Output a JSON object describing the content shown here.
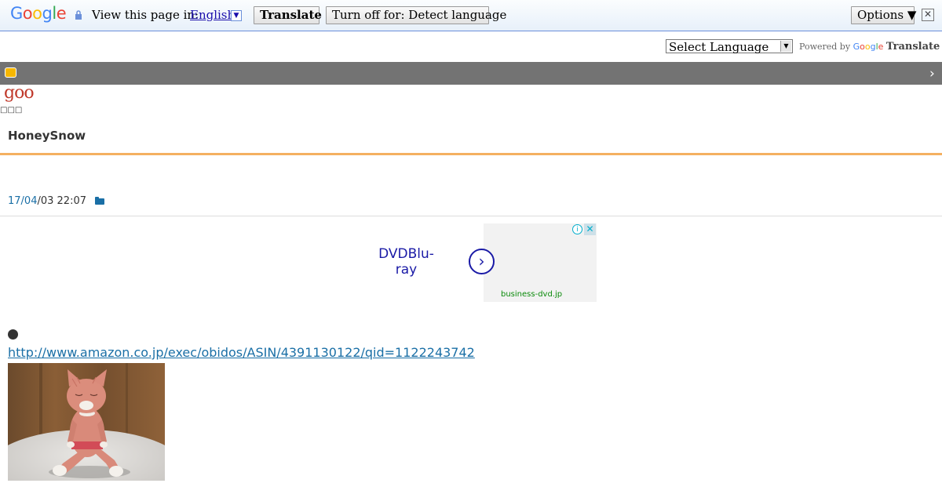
{
  "translate_bar": {
    "logo": [
      "G",
      "o",
      "o",
      "g",
      "l",
      "e"
    ],
    "view_text": "View this page in:",
    "language": "English",
    "translate_label": "Translate",
    "turn_off_label": "Turn off for: Detect language",
    "options_label": "Options ▼",
    "close_label": "✕"
  },
  "language_widget": {
    "select_value": "Select Language",
    "powered_by": "Powered by",
    "google_label": "Google",
    "translate_label": "Translate"
  },
  "site": {
    "logo": "goo",
    "boxes": "□□□",
    "blog_title": "HoneySnow"
  },
  "post": {
    "date_link": "17/04",
    "date_rest": "/03 22:07",
    "amazon_url": "http://www.amazon.co.jp/exec/obidos/ASIN/4391130122/qid=1122243742"
  },
  "ad": {
    "text": "DVDBlu-ray",
    "domain": "business-dvd.jp",
    "info": "i",
    "close": "✕"
  },
  "colors": {
    "nav_bar": "#737373",
    "orange_line": "#f4b061",
    "link": "#1a6fa6",
    "goo_red": "#c0392b"
  }
}
